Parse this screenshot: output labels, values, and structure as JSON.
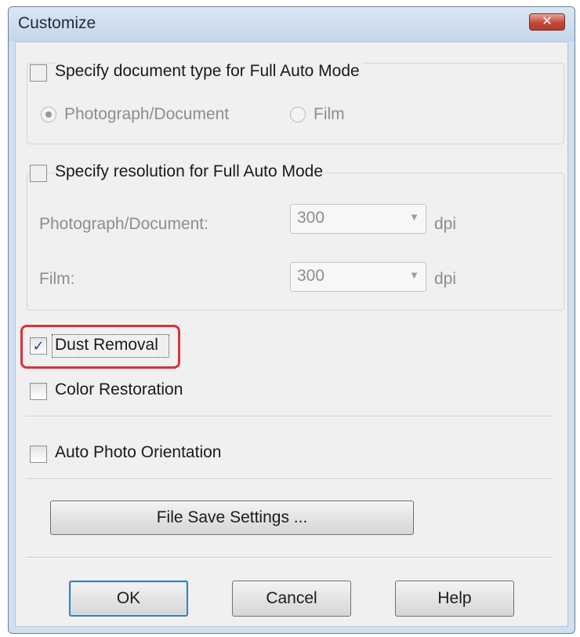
{
  "window": {
    "title": "Customize",
    "close_glyph": "✕"
  },
  "full_auto_doc_type": {
    "checkbox_label": "Specify document type for Full Auto Mode",
    "checked": false,
    "options": [
      "Photograph/Document",
      "Film"
    ],
    "selected": "Photograph/Document"
  },
  "full_auto_resolution": {
    "checkbox_label": "Specify resolution for Full Auto Mode",
    "checked": false,
    "rows": [
      {
        "label": "Photograph/Document:",
        "value": "300",
        "unit": "dpi"
      },
      {
        "label": "Film:",
        "value": "300",
        "unit": "dpi"
      }
    ]
  },
  "dust_removal": {
    "label": "Dust Removal",
    "checked": true
  },
  "color_restoration": {
    "label": "Color Restoration",
    "checked": false
  },
  "auto_photo_orientation": {
    "label": "Auto Photo Orientation",
    "checked": false
  },
  "file_save_settings_button": "File Save Settings ...",
  "buttons": {
    "ok": "OK",
    "cancel": "Cancel",
    "help": "Help"
  },
  "icons": {
    "check": "✓",
    "dropdown": "▼"
  },
  "colors": {
    "highlight": "#d9323a",
    "close_button": "#c4483a",
    "default_button": "#3c7fb1"
  }
}
